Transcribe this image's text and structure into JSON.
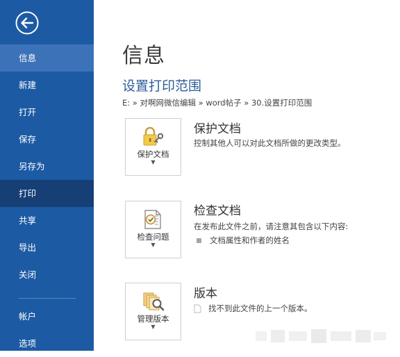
{
  "sidebar": {
    "back_icon": "back-arrow-circle-icon",
    "items": [
      {
        "label": "信息"
      },
      {
        "label": "新建"
      },
      {
        "label": "打开"
      },
      {
        "label": "保存"
      },
      {
        "label": "另存为"
      },
      {
        "label": "打印"
      },
      {
        "label": "共享"
      },
      {
        "label": "导出"
      },
      {
        "label": "关闭"
      },
      {
        "label": "帐户"
      },
      {
        "label": "选项"
      }
    ]
  },
  "main": {
    "page_title": "信息",
    "doc_title": "设置打印范围",
    "breadcrumb": "E: » 对啊网微信编辑 » word帖子 » 30.设置打印范围",
    "sections": [
      {
        "tile_label": "保护文档",
        "tile_icon": "lock-key-icon",
        "title": "保护文档",
        "description": "控制其他人可以对此文档所做的更改类型。"
      },
      {
        "tile_label": "检查问题",
        "tile_icon": "inspect-document-icon",
        "title": "检查文档",
        "description": "在发布此文件之前，请注意其包含以下内容:",
        "bullets": [
          "文档属性和作者的姓名"
        ]
      },
      {
        "tile_label": "管理版本",
        "tile_icon": "manage-versions-icon",
        "title": "版本",
        "description": "找不到此文件的上一个版本。"
      }
    ]
  },
  "colors": {
    "sidebar_bg": "#1c5aa4",
    "sidebar_active_info": "#3c73b8",
    "sidebar_active_print": "#153f75",
    "doc_title": "#2e5c9a"
  }
}
